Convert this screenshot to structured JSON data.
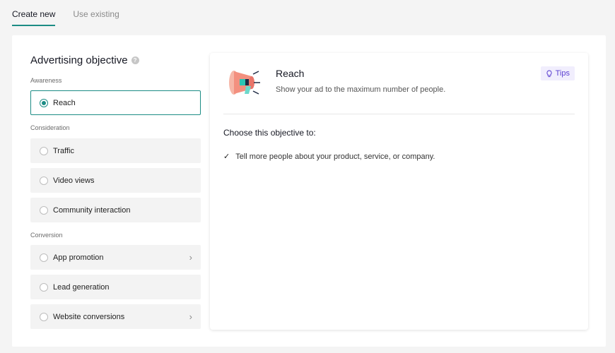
{
  "tabs": [
    {
      "label": "Create new",
      "active": true
    },
    {
      "label": "Use existing",
      "active": false
    }
  ],
  "objective": {
    "title": "Advertising objective",
    "help_icon": "question-circle-icon",
    "sections": {
      "awareness": "Awareness",
      "consideration": "Consideration",
      "conversion": "Conversion"
    },
    "options": {
      "reach": "Reach",
      "traffic": "Traffic",
      "video_views": "Video views",
      "community_interaction": "Community interaction",
      "app_promotion": "App promotion",
      "lead_generation": "Lead generation",
      "website_conversions": "Website conversions"
    },
    "selected": "Reach"
  },
  "detail": {
    "icon": "megaphone-icon",
    "title": "Reach",
    "subtitle": "Show your ad to the maximum number of people.",
    "tips_label": "Tips",
    "choose_heading": "Choose this objective to:",
    "bullets": [
      "Tell more people about your product, service, or company."
    ]
  },
  "colors": {
    "accent": "#1c8c85",
    "tips_text": "#5a3fd1",
    "tips_bg": "#f1eefd"
  }
}
